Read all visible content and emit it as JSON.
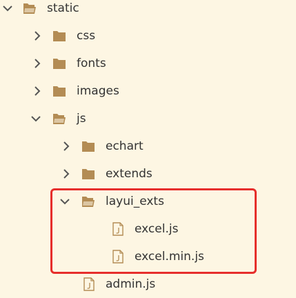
{
  "colors": {
    "background": "#fdf6e3",
    "folder": "#b38c54",
    "chevron": "#555555",
    "file_outline": "#b38c54",
    "text": "#333333",
    "highlight": "#e62e2b"
  },
  "tree": {
    "static": {
      "label": "static",
      "expanded": true,
      "icon": "folder-open-icon"
    },
    "css": {
      "label": "css",
      "expanded": false,
      "icon": "folder-icon"
    },
    "fonts": {
      "label": "fonts",
      "expanded": false,
      "icon": "folder-icon"
    },
    "images": {
      "label": "images",
      "expanded": false,
      "icon": "folder-icon"
    },
    "js": {
      "label": "js",
      "expanded": true,
      "icon": "folder-open-icon"
    },
    "echart": {
      "label": "echart",
      "expanded": false,
      "icon": "folder-icon"
    },
    "extends": {
      "label": "extends",
      "expanded": false,
      "icon": "folder-icon"
    },
    "layui_exts": {
      "label": "layui_exts",
      "expanded": true,
      "icon": "folder-open-icon"
    },
    "excel_js": {
      "label": "excel.js",
      "icon": "js-file-icon"
    },
    "excel_min_js": {
      "label": "excel.min.js",
      "icon": "js-file-icon"
    },
    "admin_js": {
      "label": "admin.js",
      "icon": "js-file-icon"
    }
  }
}
